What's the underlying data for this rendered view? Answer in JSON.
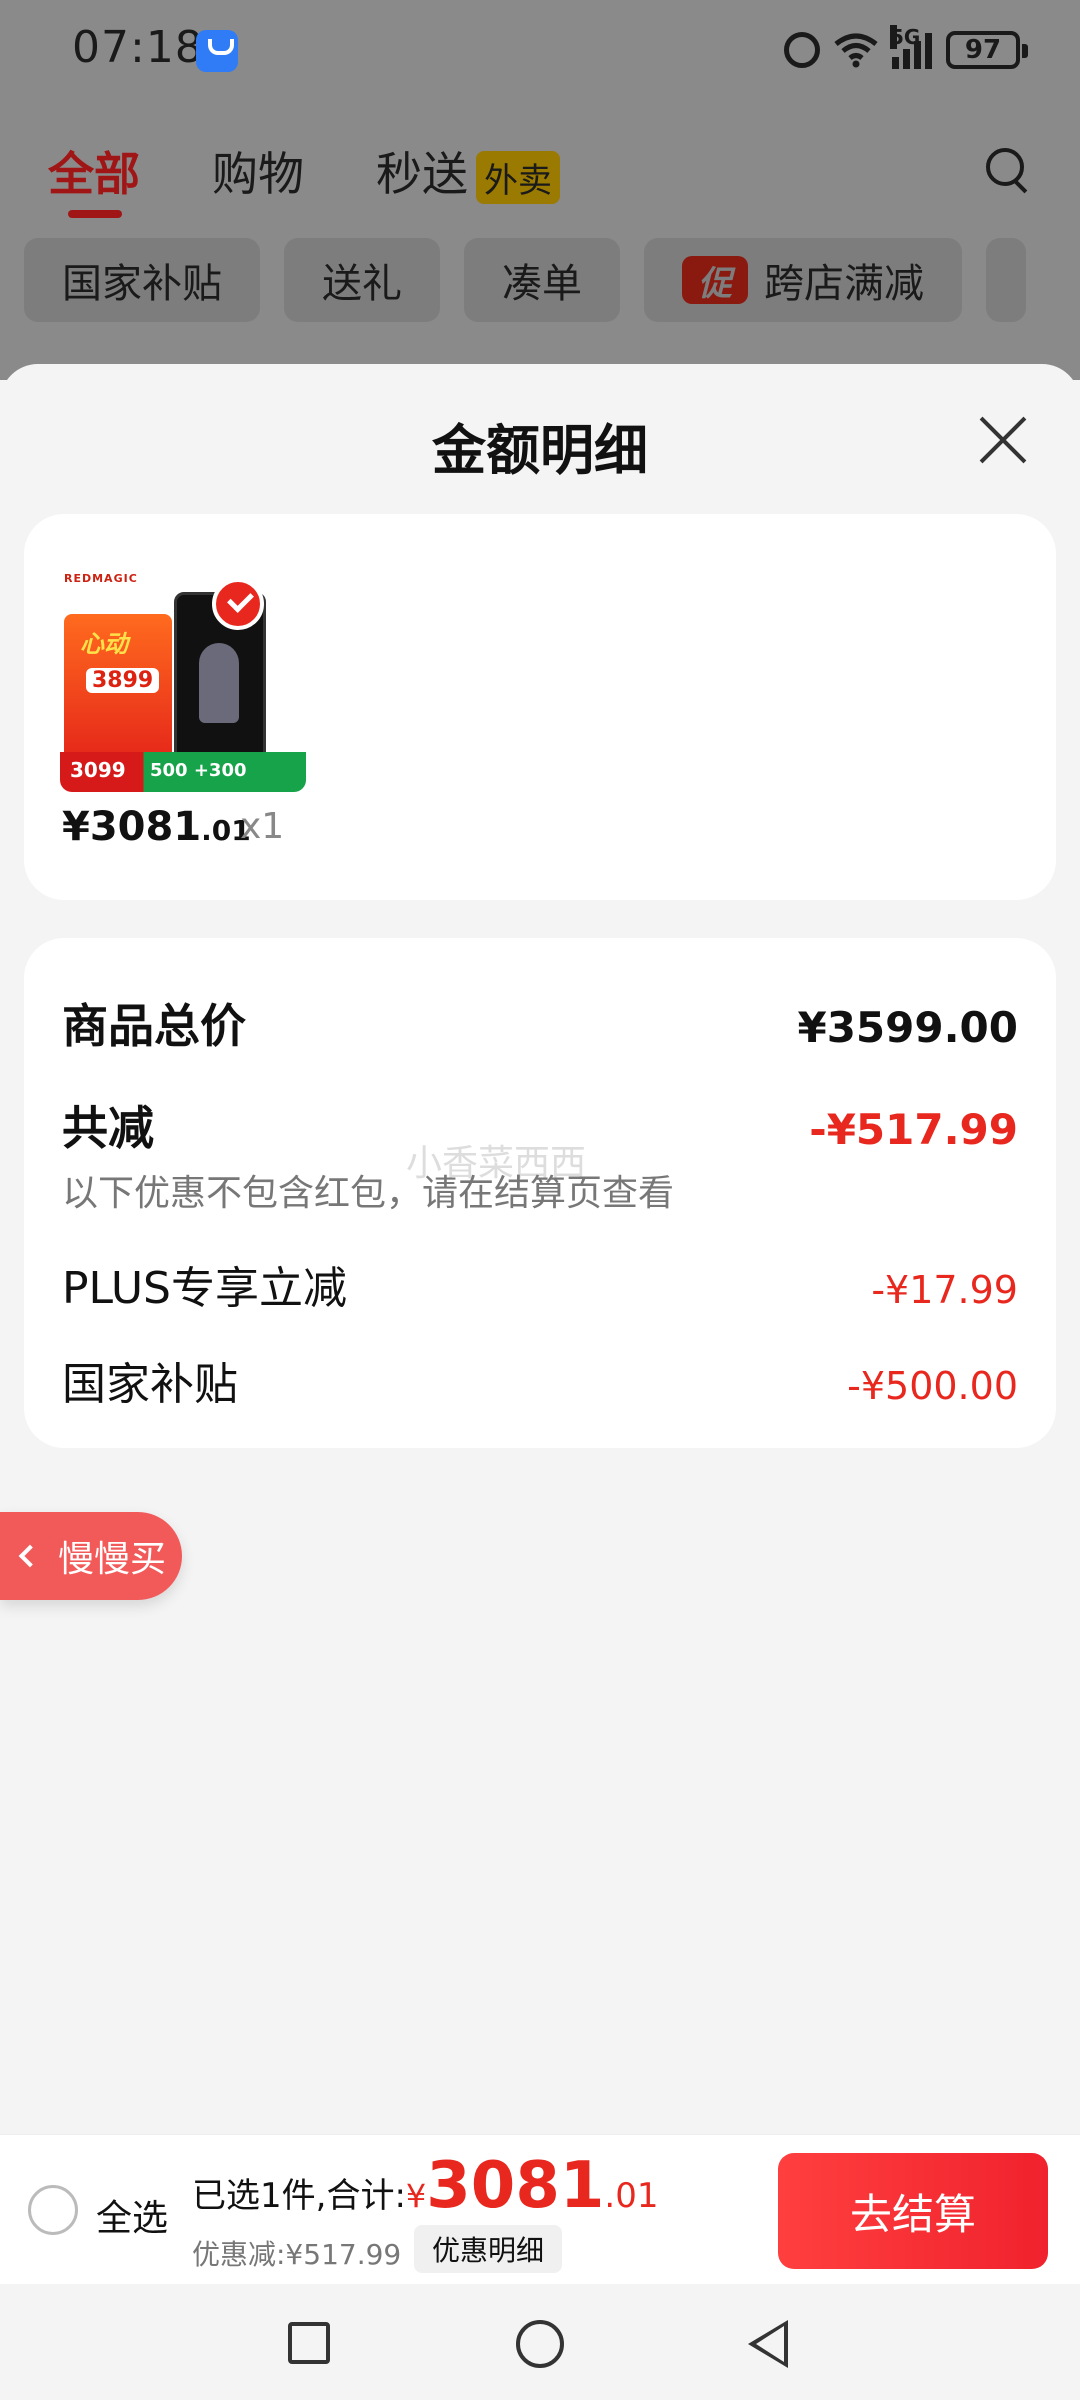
{
  "status_bar": {
    "time": "07:18",
    "network": "5G",
    "battery": "97"
  },
  "top_tabs": [
    {
      "label": "全部",
      "active": true
    },
    {
      "label": "购物",
      "active": false
    },
    {
      "label": "秒送",
      "active": false,
      "tag": "外卖"
    }
  ],
  "filter_chips": [
    {
      "label": "国家补贴"
    },
    {
      "label": "送礼"
    },
    {
      "label": "凑单"
    },
    {
      "label": "跨店满减",
      "badge": "促"
    }
  ],
  "sheet": {
    "title": "金额明细"
  },
  "product": {
    "brand": "REDMAGIC",
    "promo_text": "心动",
    "old_price": "3899",
    "strip_left": "3099",
    "strip_right": "500  +300",
    "price_main": "¥3081",
    "price_cents": ".01",
    "quantity": "x1"
  },
  "price_detail": {
    "total_label": "商品总价",
    "total_value": "¥3599.00",
    "discount_label": "共减",
    "discount_value": "-¥517.99",
    "note": "以下优惠不包含红包，请在结算页查看",
    "watermark": "小香菜西西",
    "items": [
      {
        "label": "PLUS专享立减",
        "value": "-¥17.99"
      },
      {
        "label": "国家补贴",
        "value": "-¥500.00"
      }
    ]
  },
  "slow_buy": {
    "label": "慢慢买"
  },
  "checkout": {
    "select_all": "全选",
    "summary_prefix": "已选1件,合计:",
    "currency": "¥",
    "total_int": "3081",
    "total_cents": ".01",
    "discount_text": "优惠减:¥517.99",
    "detail_button": "优惠明细",
    "checkout_button": "去结算"
  },
  "colors": {
    "accent_red": "#e8281e",
    "checkout_red": "#f0222d",
    "dim_overlay": "#8a8a8a"
  }
}
